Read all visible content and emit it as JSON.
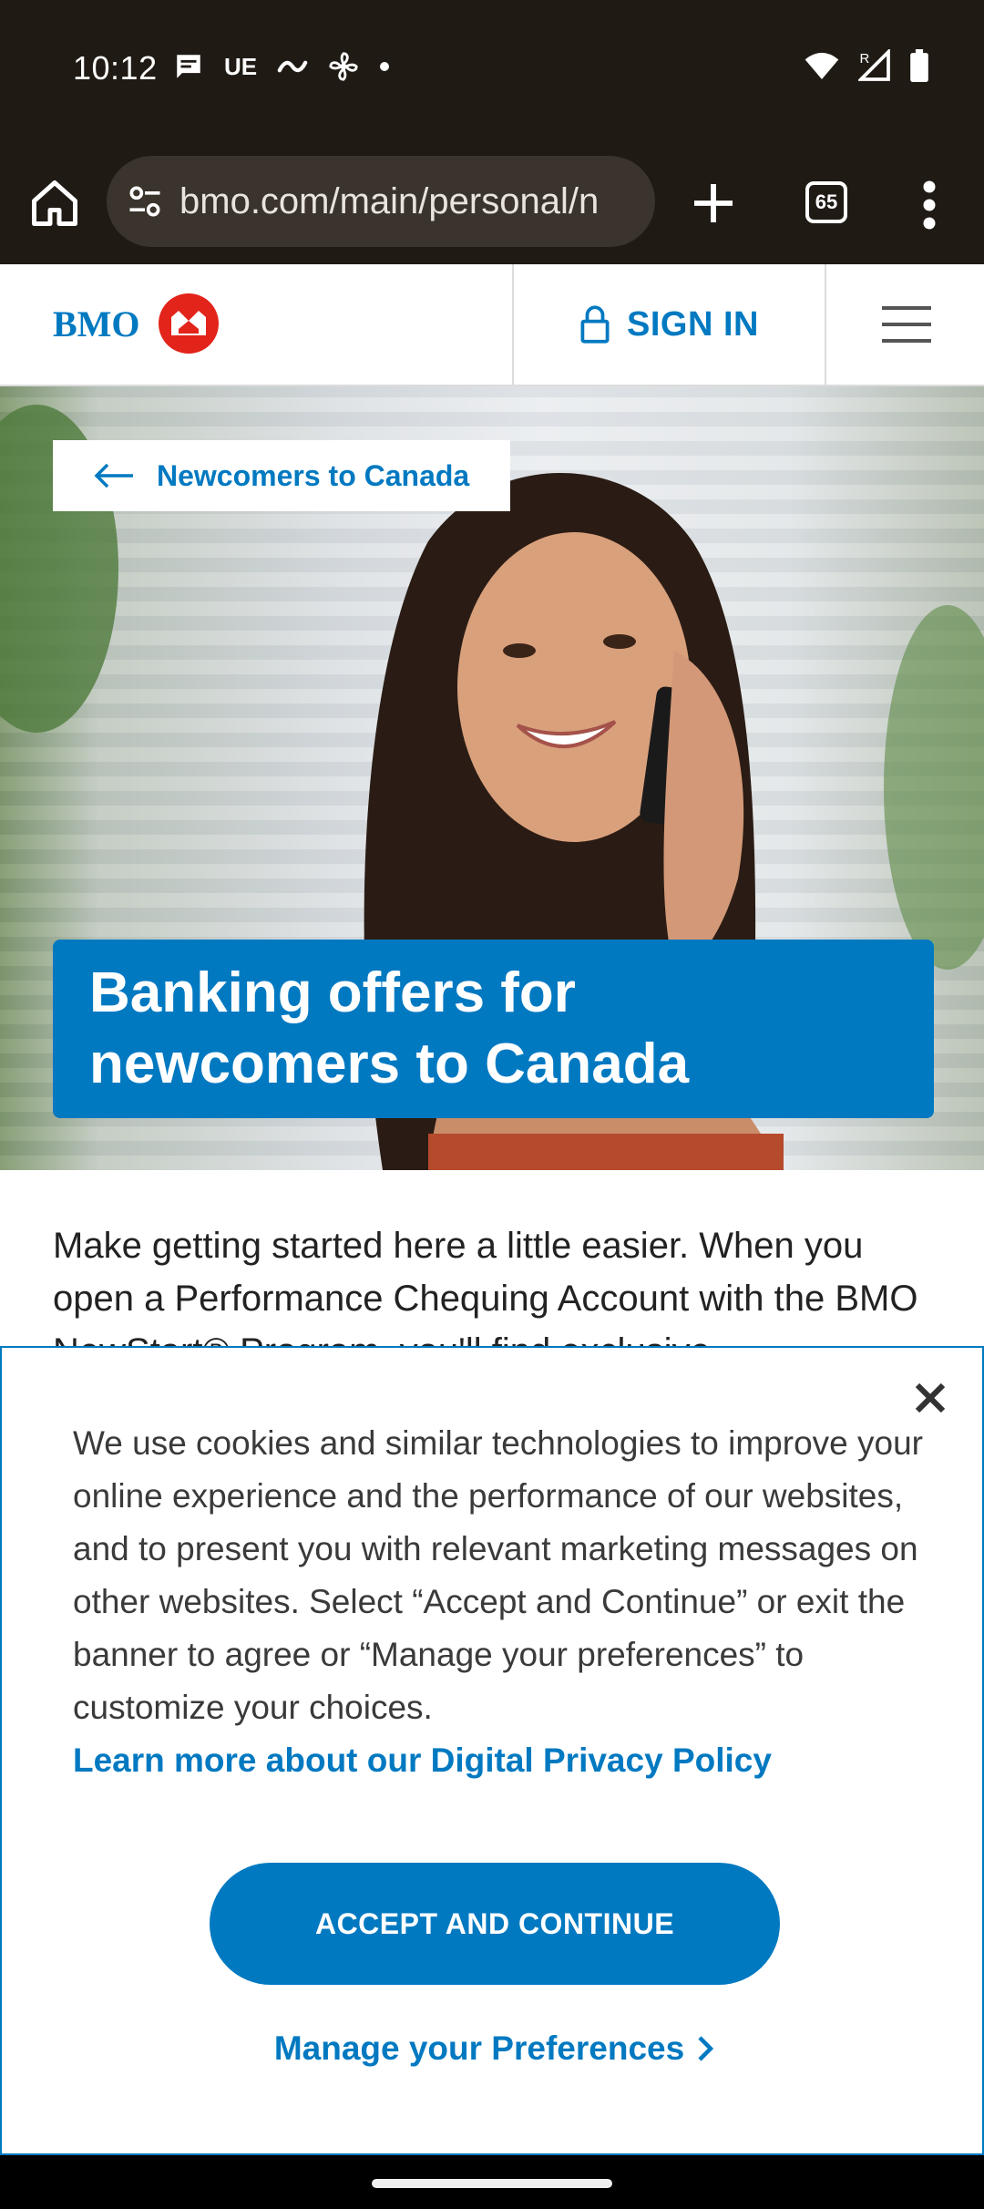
{
  "status_bar": {
    "time": "10:12",
    "left_icons": [
      "message-icon",
      "ue-text",
      "wave-icon",
      "fan-icon",
      "dot"
    ],
    "ue_text": "UE",
    "right_icons": [
      "wifi-icon",
      "signal-icon",
      "battery-icon"
    ],
    "signal_label": "R"
  },
  "browser": {
    "url": "bmo.com/main/personal/n",
    "tab_count": "65"
  },
  "header": {
    "logo_text": "BMO",
    "sign_in_label": "SIGN IN"
  },
  "hero": {
    "back_link": "Newcomers to Canada",
    "title_line1": "Banking offers for",
    "title_line2": "newcomers to Canada"
  },
  "intro": {
    "text": "Make getting started here a little easier. When you open a Performance Chequing Account with the BMO NewStart® Program, you'll find exclusive"
  },
  "cookie_banner": {
    "text": "We use cookies and similar technologies to improve your online experience and the performance of our websites, and to present you with relevant marketing messages on other websites. Select “Accept and Continue” or exit the banner to agree or “Manage your preferences” to customize your choices.",
    "privacy_link": "Learn more about our Digital Privacy Policy",
    "accept_label": "ACCEPT AND CONTINUE",
    "manage_label": "Manage your Preferences"
  },
  "colors": {
    "brand_blue": "#0079c1",
    "brand_red": "#e2241a",
    "chrome_bg": "#1f1a14"
  }
}
